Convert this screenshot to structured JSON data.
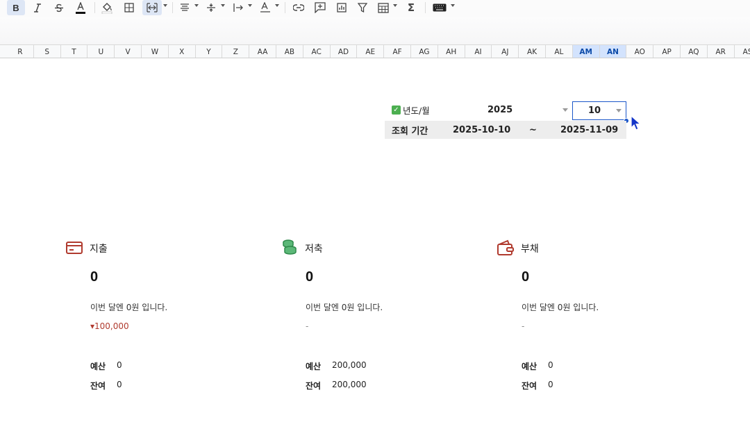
{
  "toolbar": {
    "items": [
      "bold",
      "italic",
      "strikethrough",
      "text-color",
      "fill-color",
      "borders",
      "merge-cells",
      "align-horizontal",
      "align-vertical",
      "text-wrap",
      "text-rotate",
      "link",
      "comment",
      "chart",
      "filter",
      "table",
      "function",
      "keyboard"
    ],
    "bold_label": "B",
    "function_label": "Σ"
  },
  "columns": [
    "R",
    "S",
    "T",
    "U",
    "V",
    "W",
    "X",
    "Y",
    "Z",
    "AA",
    "AB",
    "AC",
    "AD",
    "AE",
    "AF",
    "AG",
    "AH",
    "AI",
    "AJ",
    "AK",
    "AL",
    "AM",
    "AN",
    "AO",
    "AP",
    "AQ",
    "AR",
    "AS"
  ],
  "selected_columns": [
    "AM",
    "AN"
  ],
  "filter": {
    "year_month_label": "년도/월",
    "year": "2025",
    "month": "10",
    "period_label": "조회 기간",
    "start_date": "2025-10-10",
    "separator": "~",
    "end_date": "2025-11-09"
  },
  "cards": [
    {
      "title": "지출",
      "amount": "0",
      "description": "이번 달엔 0원 입니다.",
      "change": "▾100,000",
      "budget_label": "예산",
      "budget": "0",
      "remaining_label": "잔여",
      "remaining": "0",
      "icon": "credit-card-icon",
      "color": "#b03a2e"
    },
    {
      "title": "저축",
      "amount": "0",
      "description": "이번 달엔 0원 입니다.",
      "change": "-",
      "budget_label": "예산",
      "budget": "200,000",
      "remaining_label": "잔여",
      "remaining": "200,000",
      "icon": "coins-icon",
      "color": "#3aa35a"
    },
    {
      "title": "부채",
      "amount": "0",
      "description": "이번 달엔 0원 입니다.",
      "change": "-",
      "budget_label": "예산",
      "budget": "0",
      "remaining_label": "잔여",
      "remaining": "0",
      "icon": "wallet-icon",
      "color": "#b03a2e"
    }
  ],
  "colors": {
    "accent": "#1a56c9",
    "selected_header": "#d3e3fd",
    "period_band": "#ededed",
    "negative": "#b03a2e"
  }
}
